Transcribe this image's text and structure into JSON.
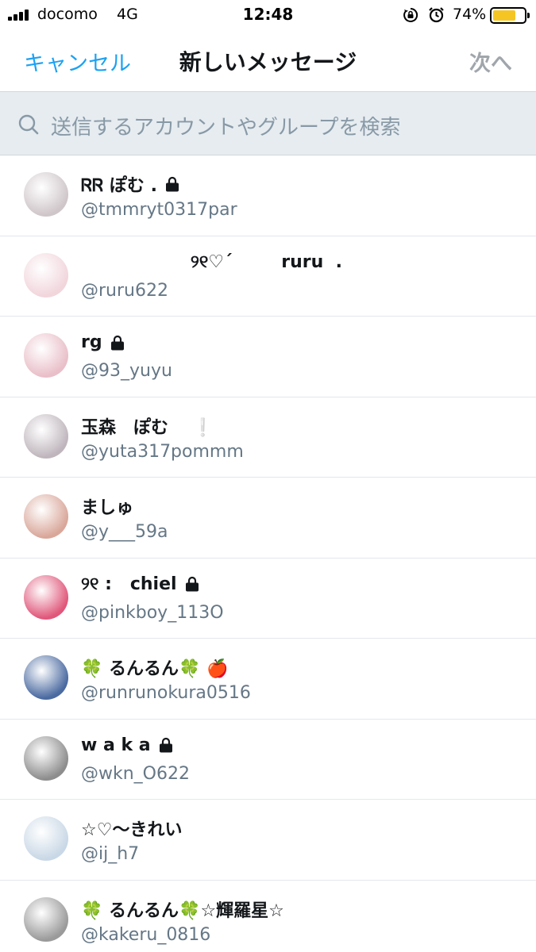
{
  "status_bar": {
    "carrier": "docomo",
    "network": "4G",
    "time": "12:48",
    "battery_percent": "74%",
    "battery_level": 0.74,
    "battery_color": "#f5c623",
    "icons": [
      "signal-icon",
      "rotation-lock-icon",
      "alarm-icon",
      "battery-icon"
    ]
  },
  "nav": {
    "cancel_label": "キャンセル",
    "title": "新しいメッセージ",
    "next_label": "次へ"
  },
  "search": {
    "placeholder": "送信するアカウントやグループを検索"
  },
  "accent_color": "#1da1f2",
  "accounts": [
    {
      "name": "ᏒᏒ ぽむ .",
      "handle": "@tmmryt0317par",
      "protected": true,
      "avatar_color": "#cfc6c9"
    },
    {
      "name": "                  ୨୧♡ˊ        ruru  .",
      "handle": "@ruru622",
      "protected": false,
      "avatar_color": "#f1d6dc"
    },
    {
      "name": "rg",
      "handle": "@93_yuyu",
      "protected": true,
      "avatar_color": "#e9bfc9"
    },
    {
      "name": "玉森　ぽむ　 ❕",
      "handle": "@yuta317pommm",
      "protected": false,
      "avatar_color": "#bfb6bd"
    },
    {
      "name": "ましゅ",
      "handle": "@y___59a",
      "protected": false,
      "avatar_color": "#d9a79a"
    },
    {
      "name": "୨୧ :   chiel",
      "handle": "@pinkboy_113O",
      "protected": true,
      "avatar_color": "#e0577a"
    },
    {
      "name": "🍀 るんるん🍀 🍎",
      "handle": "@runrunokura0516",
      "protected": false,
      "avatar_color": "#4a6aa0"
    },
    {
      "name": "w a k a",
      "handle": "@wkn_O622",
      "protected": true,
      "avatar_color": "#8d8d8d"
    },
    {
      "name": "☆♡〜きれい",
      "handle": "@ij_h7",
      "protected": false,
      "avatar_color": "#c9d8e6"
    },
    {
      "name": "🍀 るんるん🍀☆輝羅星☆",
      "handle": "@kakeru_0816",
      "protected": false,
      "avatar_color": "#9a9a9a"
    }
  ]
}
